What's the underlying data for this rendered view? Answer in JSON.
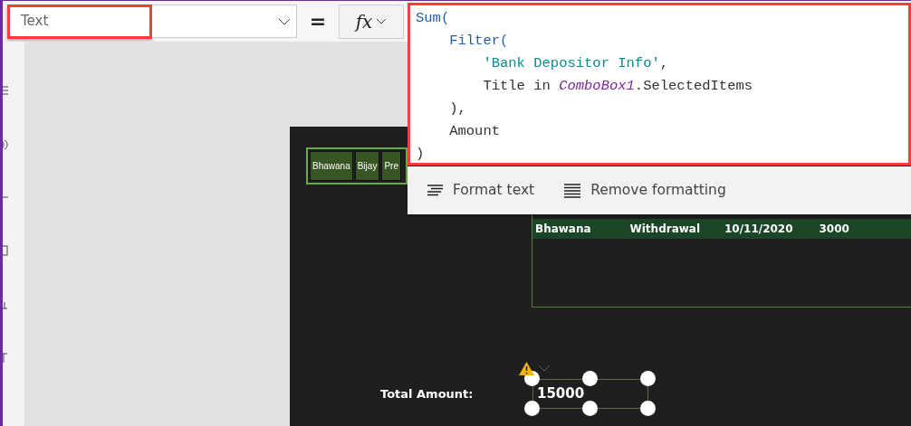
{
  "property_selector": {
    "value": "Text",
    "highlighted": true
  },
  "equals": "=",
  "fx_button": {
    "label": "fx"
  },
  "formula_editor": {
    "highlighted": true,
    "lines": [
      [
        {
          "text": "Sum(",
          "kind": "function"
        }
      ],
      [
        {
          "text": "    Filter(",
          "kind": "function"
        }
      ],
      [
        {
          "text": "        'Bank Depositor Info'",
          "kind": "string"
        },
        {
          "text": ",",
          "kind": "plain"
        }
      ],
      [
        {
          "text": "        Title in ",
          "kind": "plain"
        },
        {
          "text": "ComboBox1",
          "kind": "control"
        },
        {
          "text": ".SelectedItems",
          "kind": "plain"
        }
      ],
      [
        {
          "text": "    ),",
          "kind": "plain"
        }
      ],
      [
        {
          "text": "    Amount",
          "kind": "plain"
        }
      ],
      [
        {
          "text": ")",
          "kind": "plain"
        }
      ]
    ]
  },
  "format_toolbar": [
    {
      "label": "Format text",
      "kind": "format"
    },
    {
      "label": "Remove formatting",
      "kind": "remove"
    }
  ],
  "canvas": {
    "combo_chips": [
      "Bhawana",
      "Bijay",
      "Pre"
    ],
    "gallery_rows": [
      {
        "cells": [
          "Bhawana",
          "Withdrawal",
          "10/11/2020",
          "3000"
        ]
      }
    ],
    "total_label": "Total Amount:",
    "total_value": {
      "text": "15000",
      "selected": true,
      "warning": true
    }
  }
}
